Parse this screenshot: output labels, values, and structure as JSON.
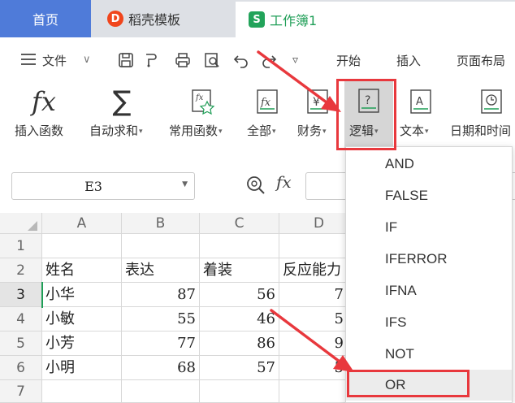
{
  "tabs": {
    "home": "首页",
    "template": "稻壳模板",
    "template_logo": "D",
    "workbook": "工作簿1",
    "workbook_logo": "S"
  },
  "menu": {
    "file": "文件",
    "items": [
      "开始",
      "插入",
      "页面布局"
    ]
  },
  "ribbon": {
    "insert_function": "插入函数",
    "autosum": "自动求和",
    "common_functions": "常用函数",
    "all": "全部",
    "finance": "财务",
    "logic": "逻辑",
    "text": "文本",
    "datetime": "日期和时间"
  },
  "formula_bar": {
    "name_box": "E3",
    "fx": "fx"
  },
  "sheet": {
    "columns": [
      "A",
      "B",
      "C",
      "D"
    ],
    "row_numbers": [
      "1",
      "2",
      "3",
      "4",
      "5",
      "6",
      "7"
    ],
    "header_row": [
      "姓名",
      "表达",
      "着装",
      "反应能力"
    ],
    "rows": [
      {
        "name": "小华",
        "b": "87",
        "c": "56",
        "d": "7"
      },
      {
        "name": "小敏",
        "b": "55",
        "c": "46",
        "d": "5"
      },
      {
        "name": "小芳",
        "b": "77",
        "c": "86",
        "d": "9"
      },
      {
        "name": "小明",
        "b": "68",
        "c": "57",
        "d": "5"
      }
    ]
  },
  "logic_menu": {
    "items": [
      "AND",
      "FALSE",
      "IF",
      "IFERROR",
      "IFNA",
      "IFS",
      "NOT",
      "OR"
    ],
    "highlighted": "OR"
  },
  "colors": {
    "home_tab": "#4f7bd9",
    "accent_green": "#1f9e57",
    "annotation_red": "#e8383d"
  }
}
